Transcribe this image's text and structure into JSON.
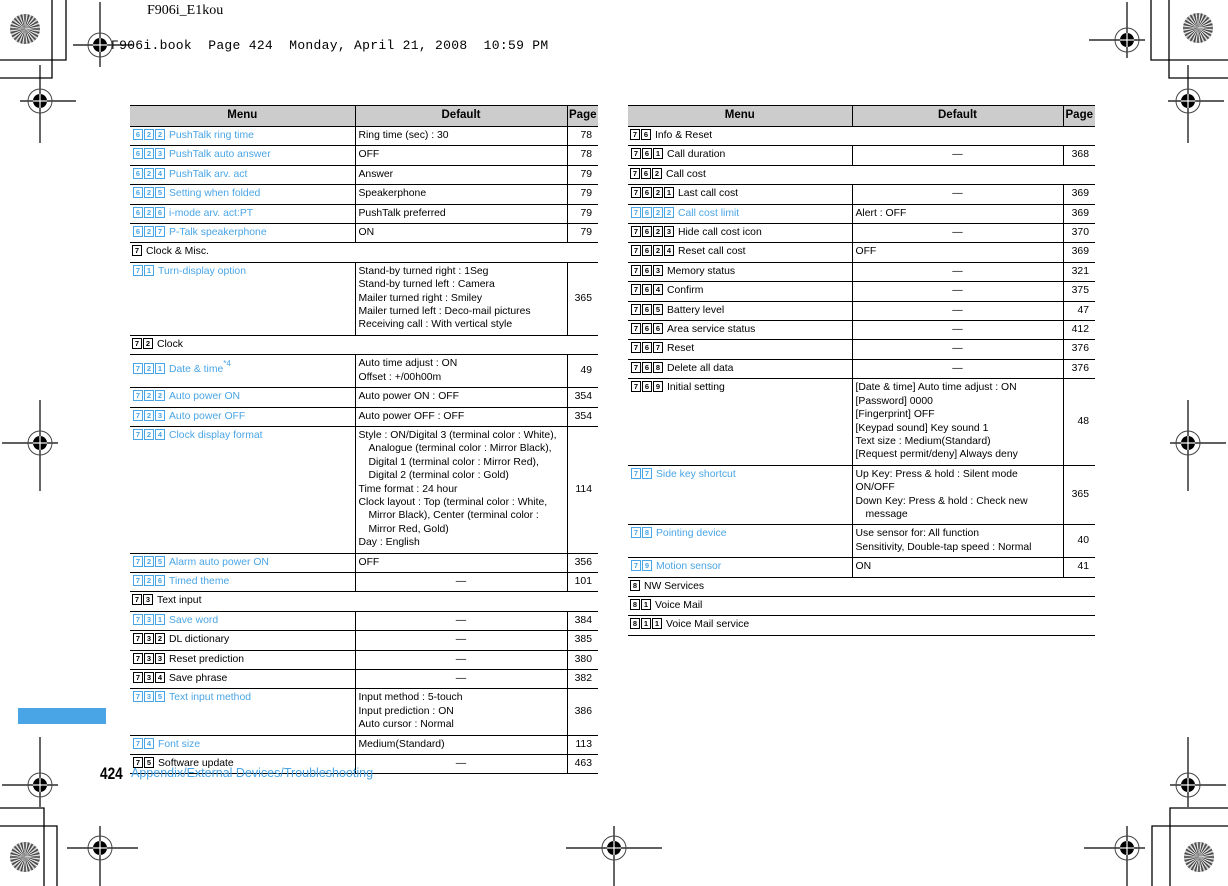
{
  "header": {
    "doc_id": "F906i_E1kou",
    "book_line": "F906i.book  Page 424  Monday, April 21, 2008  10:59 PM"
  },
  "table_headers": {
    "menu": "Menu",
    "default": "Default",
    "page": "Page"
  },
  "left_table": {
    "rows": [
      {
        "type": "item",
        "link": true,
        "keys": [
          "6",
          "2",
          "2"
        ],
        "label": "PushTalk ring time",
        "default": [
          "Ring time (sec) : 30"
        ],
        "page": "78"
      },
      {
        "type": "item",
        "link": true,
        "keys": [
          "6",
          "2",
          "3"
        ],
        "label": "PushTalk auto answer",
        "default": [
          "OFF"
        ],
        "page": "78"
      },
      {
        "type": "item",
        "link": true,
        "keys": [
          "6",
          "2",
          "4"
        ],
        "label": "PushTalk arv. act",
        "default": [
          "Answer"
        ],
        "page": "79"
      },
      {
        "type": "item",
        "link": true,
        "keys": [
          "6",
          "2",
          "5"
        ],
        "label": "Setting when folded",
        "default": [
          "Speakerphone"
        ],
        "page": "79"
      },
      {
        "type": "item",
        "link": true,
        "keys": [
          "6",
          "2",
          "6"
        ],
        "label": "i-mode arv. act:PT",
        "default": [
          "PushTalk preferred"
        ],
        "page": "79"
      },
      {
        "type": "item",
        "link": true,
        "keys": [
          "6",
          "2",
          "7"
        ],
        "label": "P-Talk speakerphone",
        "default": [
          "ON"
        ],
        "page": "79"
      },
      {
        "type": "section",
        "keys": [
          "7"
        ],
        "label": "Clock & Misc."
      },
      {
        "type": "item",
        "link": true,
        "keys": [
          "7",
          "1"
        ],
        "label": "Turn-display option",
        "default": [
          "Stand-by turned right : 1Seg",
          "Stand-by turned left : Camera",
          "Mailer turned right : Smiley",
          "Mailer turned left : Deco-mail pictures",
          "Receiving call : With vertical style"
        ],
        "page": "365"
      },
      {
        "type": "section",
        "keys": [
          "7",
          "2"
        ],
        "label": "Clock"
      },
      {
        "type": "item",
        "link": true,
        "keys": [
          "7",
          "2",
          "1"
        ],
        "label": "Date & time",
        "note": "*4",
        "default": [
          "Auto time adjust : ON",
          "Offset : +/00h00m"
        ],
        "page": "49"
      },
      {
        "type": "item",
        "link": true,
        "keys": [
          "7",
          "2",
          "2"
        ],
        "label": "Auto power ON",
        "default": [
          "Auto power ON : OFF"
        ],
        "page": "354"
      },
      {
        "type": "item",
        "link": true,
        "keys": [
          "7",
          "2",
          "3"
        ],
        "label": "Auto power OFF",
        "default": [
          "Auto power OFF : OFF"
        ],
        "page": "354"
      },
      {
        "type": "item",
        "link": true,
        "keys": [
          "7",
          "2",
          "4"
        ],
        "label": "Clock display format",
        "default": [
          "Style : ON/Digital 3 (terminal color : White),",
          "~Analogue (terminal color : Mirror Black),",
          "~Digital 1 (terminal color : Mirror Red),",
          "~Digital 2 (terminal color : Gold)",
          "Time format : 24 hour",
          "Clock layout : Top (terminal color : White,",
          "~Mirror Black), Center (terminal color :",
          "~Mirror Red, Gold)",
          "Day : English"
        ],
        "page": "114"
      },
      {
        "type": "item",
        "link": true,
        "keys": [
          "7",
          "2",
          "5"
        ],
        "label": "Alarm auto power ON",
        "default": [
          "OFF"
        ],
        "page": "356"
      },
      {
        "type": "item",
        "link": true,
        "keys": [
          "7",
          "2",
          "6"
        ],
        "label": "Timed theme",
        "default": [
          "—"
        ],
        "center": true,
        "page": "101"
      },
      {
        "type": "section",
        "keys": [
          "7",
          "3"
        ],
        "label": "Text input"
      },
      {
        "type": "item",
        "link": true,
        "keys": [
          "7",
          "3",
          "1"
        ],
        "label": "Save word",
        "default": [
          "—"
        ],
        "center": true,
        "page": "384"
      },
      {
        "type": "item",
        "link": false,
        "keys": [
          "7",
          "3",
          "2"
        ],
        "label": "DL dictionary",
        "default": [
          "—"
        ],
        "center": true,
        "page": "385"
      },
      {
        "type": "item",
        "link": false,
        "keys": [
          "7",
          "3",
          "3"
        ],
        "label": "Reset prediction",
        "default": [
          "—"
        ],
        "center": true,
        "page": "380"
      },
      {
        "type": "item",
        "link": false,
        "keys": [
          "7",
          "3",
          "4"
        ],
        "label": "Save phrase",
        "default": [
          "—"
        ],
        "center": true,
        "page": "382"
      },
      {
        "type": "item",
        "link": true,
        "keys": [
          "7",
          "3",
          "5"
        ],
        "label": "Text input method",
        "default": [
          "Input method : 5-touch",
          "Input prediction : ON",
          "Auto cursor : Normal"
        ],
        "page": "386"
      },
      {
        "type": "item",
        "link": true,
        "keys": [
          "7",
          "4"
        ],
        "label": "Font size",
        "default": [
          "Medium(Standard)"
        ],
        "page": "113"
      },
      {
        "type": "item",
        "link": false,
        "keys": [
          "7",
          "5"
        ],
        "label": "Software update",
        "default": [
          "—"
        ],
        "center": true,
        "page": "463"
      }
    ]
  },
  "right_table": {
    "rows": [
      {
        "type": "section",
        "keys": [
          "7",
          "6"
        ],
        "label": "Info & Reset"
      },
      {
        "type": "item",
        "link": false,
        "keys": [
          "7",
          "6",
          "1"
        ],
        "label": "Call duration",
        "default": [
          "—"
        ],
        "center": true,
        "page": "368"
      },
      {
        "type": "section",
        "keys": [
          "7",
          "6",
          "2"
        ],
        "label": "Call cost"
      },
      {
        "type": "item",
        "link": false,
        "keys": [
          "7",
          "6",
          "2",
          "1"
        ],
        "label": "Last call cost",
        "default": [
          "—"
        ],
        "center": true,
        "page": "369"
      },
      {
        "type": "item",
        "link": true,
        "keys": [
          "7",
          "6",
          "2",
          "2"
        ],
        "label": "Call cost limit",
        "default": [
          "Alert : OFF"
        ],
        "page": "369"
      },
      {
        "type": "item",
        "link": false,
        "keys": [
          "7",
          "6",
          "2",
          "3"
        ],
        "label": "Hide call cost icon",
        "default": [
          "—"
        ],
        "center": true,
        "page": "370"
      },
      {
        "type": "item",
        "link": false,
        "keys": [
          "7",
          "6",
          "2",
          "4"
        ],
        "label": "Reset call cost",
        "default": [
          "OFF"
        ],
        "page": "369"
      },
      {
        "type": "item",
        "link": false,
        "keys": [
          "7",
          "6",
          "3"
        ],
        "label": "Memory status",
        "default": [
          "—"
        ],
        "center": true,
        "page": "321"
      },
      {
        "type": "item",
        "link": false,
        "keys": [
          "7",
          "6",
          "4"
        ],
        "label": "Confirm",
        "default": [
          "—"
        ],
        "center": true,
        "page": "375"
      },
      {
        "type": "item",
        "link": false,
        "keys": [
          "7",
          "6",
          "5"
        ],
        "label": "Battery level",
        "default": [
          "—"
        ],
        "center": true,
        "page": "47"
      },
      {
        "type": "item",
        "link": false,
        "keys": [
          "7",
          "6",
          "6"
        ],
        "label": "Area service status",
        "default": [
          "—"
        ],
        "center": true,
        "page": "412"
      },
      {
        "type": "item",
        "link": false,
        "keys": [
          "7",
          "6",
          "7"
        ],
        "label": "Reset",
        "default": [
          "—"
        ],
        "center": true,
        "page": "376"
      },
      {
        "type": "item",
        "link": false,
        "keys": [
          "7",
          "6",
          "8"
        ],
        "label": "Delete all data",
        "default": [
          "—"
        ],
        "center": true,
        "page": "376"
      },
      {
        "type": "item",
        "link": false,
        "keys": [
          "7",
          "6",
          "9"
        ],
        "label": "Initial setting",
        "default": [
          "[Date & time] Auto time adjust : ON",
          "[Password] 0000",
          "[Fingerprint] OFF",
          "[Keypad sound] Key sound 1",
          "Text size : Medium(Standard)",
          "[Request permit/deny] Always deny"
        ],
        "page": "48"
      },
      {
        "type": "item",
        "link": true,
        "keys": [
          "7",
          "7"
        ],
        "label": "Side key shortcut",
        "default": [
          "Up Key: Press & hold : Silent mode ON/OFF",
          "Down Key: Press & hold : Check new",
          "~message"
        ],
        "page": "365"
      },
      {
        "type": "item",
        "link": true,
        "keys": [
          "7",
          "8"
        ],
        "label": "Pointing device",
        "default": [
          "Use sensor for: All function",
          "Sensitivity, Double-tap speed : Normal"
        ],
        "page": "40"
      },
      {
        "type": "item",
        "link": true,
        "keys": [
          "7",
          "9"
        ],
        "label": "Motion sensor",
        "default": [
          "ON"
        ],
        "page": "41"
      },
      {
        "type": "section",
        "keys": [
          "8"
        ],
        "label": "NW Services"
      },
      {
        "type": "section",
        "keys": [
          "8",
          "1"
        ],
        "label": "Voice Mail"
      },
      {
        "type": "section",
        "keys": [
          "8",
          "1",
          "1"
        ],
        "label": "Voice Mail service"
      }
    ]
  },
  "footer": {
    "page_number": "424",
    "section_title": "Appendix/External Devices/Troubleshooting"
  },
  "colors": {
    "accent": "#4aa5e6",
    "header_bg": "#cccccc"
  }
}
